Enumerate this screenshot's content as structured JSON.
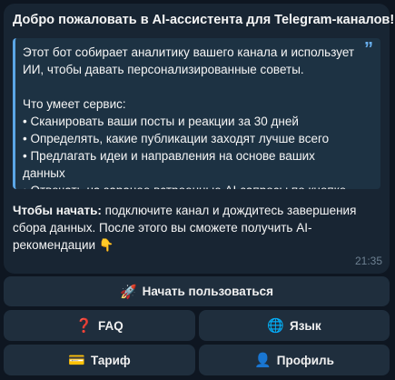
{
  "message": {
    "title": "Добро пожаловать в AI-ассистента для Telegram-каналов!",
    "title_emoji": "👋",
    "quote_mark": "”",
    "quote_lines": {
      "intro": "Этот бот собирает аналитику вашего канала и использует ИИ, чтобы давать персонализированные советы.",
      "features_heading": "Что умеет сервис:",
      "feature_1": "• Сканировать ваши посты и реакции за 30 дней",
      "feature_2": "• Определять, какие публикации заходят лучше всего",
      "feature_3": "• Предлагать идеи и направления на основе ваших данных",
      "feature_4": "• Отвечать на заранее встроенные AI-запросы по кнопке"
    },
    "start_label": "Чтобы начать:",
    "start_text": " подключите канал и дождитесь завершения сбора данных. После этого вы сможете получить AI-рекомендации",
    "start_emoji": "👇",
    "time": "21:35"
  },
  "keyboard": {
    "start": {
      "icon": "🚀",
      "label": "Начать пользоваться"
    },
    "faq": {
      "icon": "❓",
      "label": "FAQ"
    },
    "language": {
      "icon": "🌐",
      "label": "Язык"
    },
    "tariff": {
      "icon": "💳",
      "label": "Тариф"
    },
    "profile": {
      "icon": "👤",
      "label": "Профиль"
    }
  },
  "colors": {
    "background": "#0e1621",
    "bubble": "#182533",
    "quote_accent": "#5ba6e6",
    "button": "#1f2e3d"
  }
}
